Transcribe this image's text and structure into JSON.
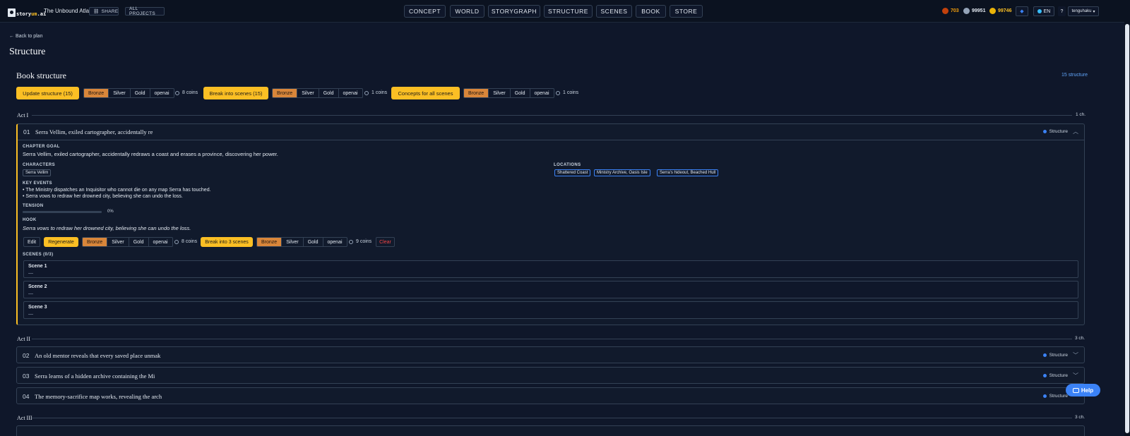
{
  "header": {
    "logo": {
      "prefix": "story",
      "accent": "um",
      "suffix": ".ai"
    },
    "project_title": "The Unbound Atlas",
    "share_label": "SHARE",
    "all_projects_label": "ALL PROJECTS",
    "nav": [
      "CONCEPT",
      "WORLD",
      "STORYGRAPH",
      "STRUCTURE",
      "SCENES",
      "BOOK",
      "STORE"
    ],
    "coins": {
      "bronze": "703",
      "silver": "99951",
      "gold": "99746"
    },
    "lang": "EN",
    "help_q": "?",
    "user": "tenguhaku"
  },
  "page": {
    "back_link": "← Back to plan",
    "title": "Structure",
    "section_title": "Book structure",
    "structure_count": "15 structure"
  },
  "toolbar": {
    "update_label": "Update structure (15)",
    "break_label": "Break into scenes (15)",
    "concepts_label": "Concepts for all scenes",
    "tiers": [
      "Bronze",
      "Silver",
      "Gold",
      "openai"
    ],
    "cost1": "8 coins",
    "cost2": "1 coins",
    "cost3": "1 coins"
  },
  "acts": [
    {
      "label": "Act I",
      "count": "1 ch."
    },
    {
      "label": "Act II",
      "count": "3 ch."
    },
    {
      "label": "Act III",
      "count": "3 ch."
    }
  ],
  "chapter_open": {
    "num": "01",
    "title": "Serra Vellim, exiled cartographer, accidentally re",
    "status": "Structure",
    "goal_label": "CHAPTER GOAL",
    "goal": "Serra Vellim, exiled cartographer, accidentally redraws a coast and erases a province, discovering her power.",
    "characters_label": "CHARACTERS",
    "characters": [
      "Serra Vellim"
    ],
    "locations_label": "LOCATIONS",
    "locations": [
      "Shattered Coast",
      "Ministry Archive, Oasis Isle",
      "Serra's hideout, Beached Hull"
    ],
    "events_label": "KEY EVENTS",
    "events": [
      "• The Ministry dispatches an Inquisitor who cannot die on any map Serra has touched.",
      "• Serra vows to redraw her drowned city, believing she can undo the loss."
    ],
    "tension_label": "TENSION",
    "tension": "0%",
    "hook_label": "HOOK",
    "hook": "Serra vows to redraw her drowned city, believing she can undo the loss.",
    "edit_label": "Edit",
    "regenerate_label": "Regenerate",
    "regen_cost": "8 coins",
    "break_label": "Break into 3 scenes",
    "break_cost": "9 coins",
    "clear_label": "Clear",
    "scenes_label": "SCENES (0/3)",
    "scenes": [
      {
        "title": "Scene 1",
        "desc": "—"
      },
      {
        "title": "Scene 2",
        "desc": "—"
      },
      {
        "title": "Scene 3",
        "desc": "—"
      }
    ]
  },
  "chapters_closed": [
    {
      "num": "02",
      "title": "An old mentor reveals that every saved place unmak",
      "status": "Structure"
    },
    {
      "num": "03",
      "title": "Serra learns of a hidden archive containing the Mi",
      "status": "Structure"
    },
    {
      "num": "04",
      "title": "The memory-sacrifice map works, revealing the arch",
      "status": "Structure"
    }
  ],
  "help_label": "Help"
}
